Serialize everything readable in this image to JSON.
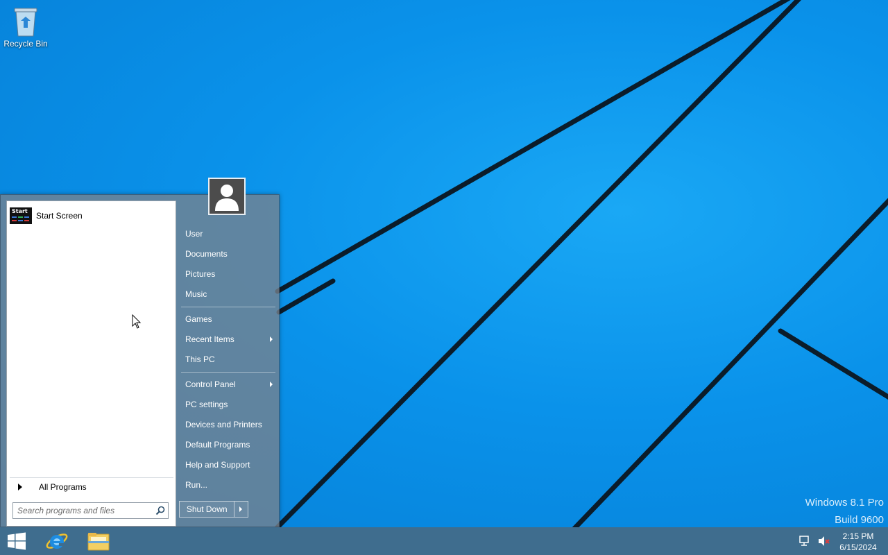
{
  "desktop": {
    "icons": [
      {
        "label": "Recycle Bin",
        "icon": "recycle-bin-icon"
      }
    ],
    "watermark": {
      "line1": "Windows 8.1 Pro",
      "line2": "Build 9600"
    }
  },
  "start_menu": {
    "pinned": [
      {
        "label": "Start Screen",
        "tile_text": "Start",
        "icon": "start-screen-icon"
      }
    ],
    "all_programs_label": "All Programs",
    "search": {
      "placeholder": "Search programs and files",
      "value": ""
    },
    "user_picture": "user-avatar-icon",
    "right_items": [
      {
        "label": "User"
      },
      {
        "label": "Documents"
      },
      {
        "label": "Pictures"
      },
      {
        "label": "Music"
      },
      {
        "label": "Games"
      },
      {
        "label": "Recent Items",
        "submenu": true
      },
      {
        "label": "This PC"
      },
      {
        "label": "Control Panel",
        "submenu": true
      },
      {
        "label": "PC settings"
      },
      {
        "label": "Devices and Printers"
      },
      {
        "label": "Default Programs"
      },
      {
        "label": "Help and Support"
      },
      {
        "label": "Run..."
      }
    ],
    "shutdown_label": "Shut Down"
  },
  "taskbar": {
    "buttons": [
      {
        "name": "start-button",
        "icon": "windows-logo-icon"
      },
      {
        "name": "internet-explorer-button",
        "icon": "internet-explorer-icon"
      },
      {
        "name": "file-explorer-button",
        "icon": "file-explorer-icon"
      }
    ],
    "tray": {
      "icons": [
        "network-icon",
        "volume-muted-icon"
      ],
      "time": "2:15 PM",
      "date": "6/15/2024"
    }
  },
  "colors": {
    "desktop_blue": "#0a8ee8",
    "taskbar": "#3f6d8e",
    "start_menu_frame": "#78828c"
  }
}
